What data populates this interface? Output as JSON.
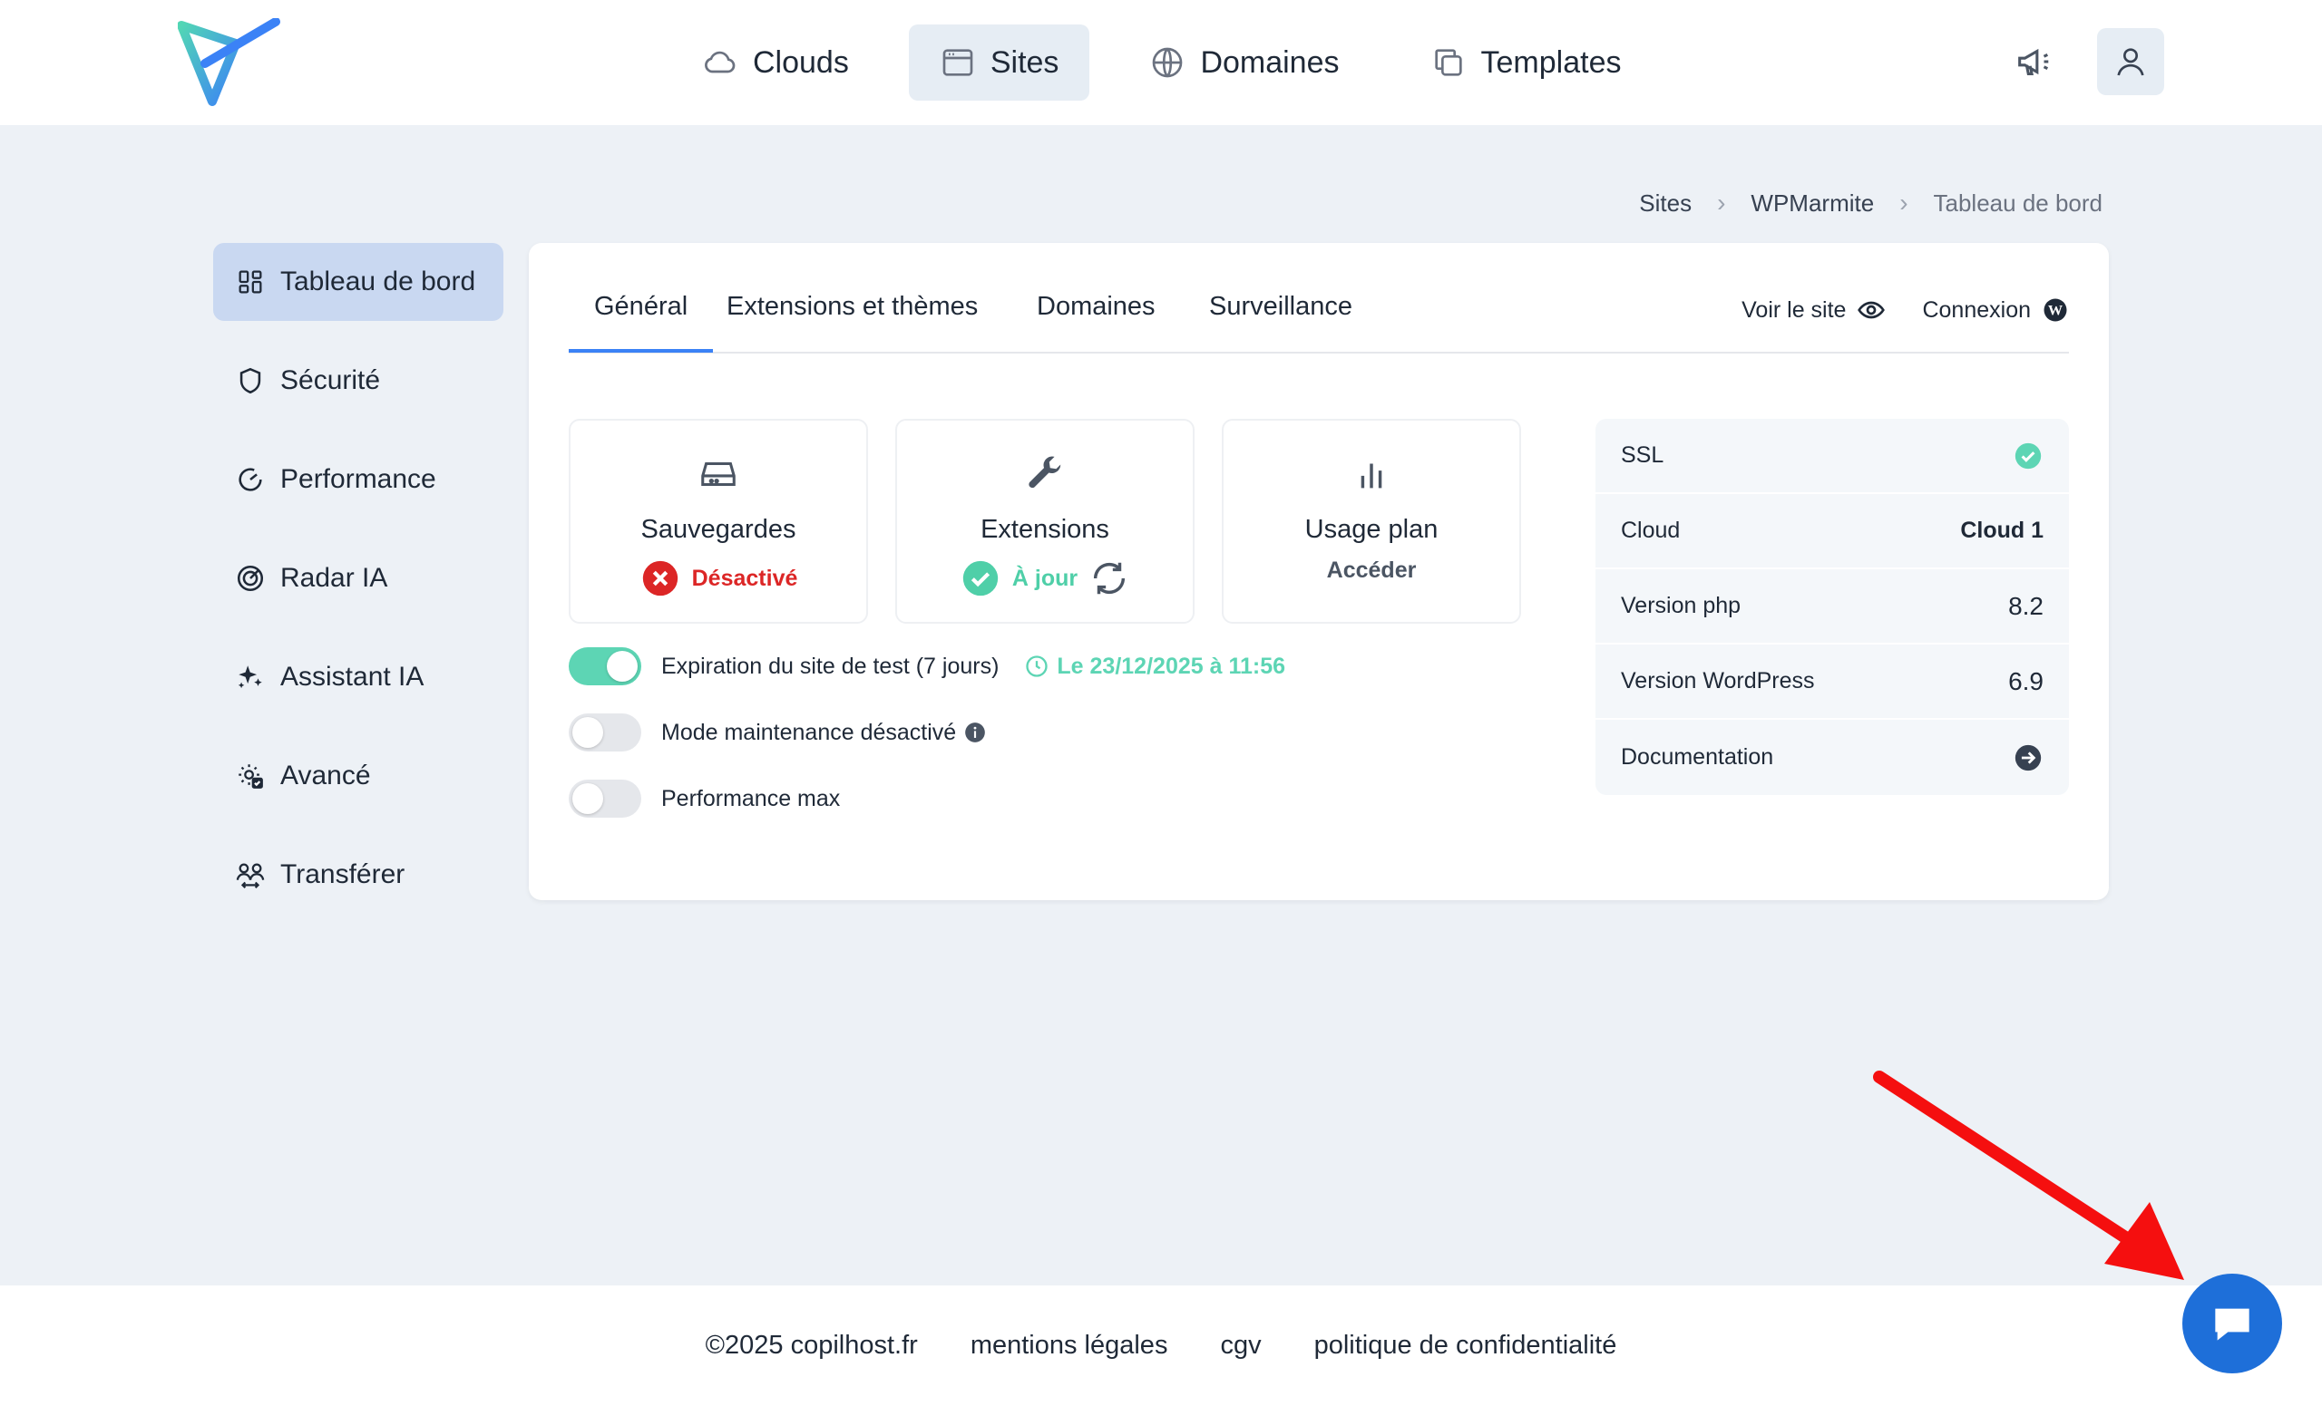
{
  "header": {
    "logo": "copilhost-logo",
    "nav": [
      {
        "label": "Clouds",
        "icon": "cloud-icon"
      },
      {
        "label": "Sites",
        "icon": "browser-window-icon",
        "active": true
      },
      {
        "label": "Domaines",
        "icon": "globe-icon"
      },
      {
        "label": "Templates",
        "icon": "copy-icon"
      }
    ],
    "announcements_icon": "megaphone-icon",
    "user_icon": "user-icon"
  },
  "breadcrumb": [
    "Sites",
    "WPMarmite",
    "Tableau de bord"
  ],
  "sidebar": {
    "items": [
      {
        "label": "Tableau de bord",
        "icon": "dashboard-grid-icon",
        "active": true
      },
      {
        "label": "Sécurité",
        "icon": "shield-icon"
      },
      {
        "label": "Performance",
        "icon": "gauge-icon"
      },
      {
        "label": "Radar IA",
        "icon": "radar-icon"
      },
      {
        "label": "Assistant IA",
        "icon": "sparkles-icon"
      },
      {
        "label": "Avancé",
        "icon": "gear-check-icon"
      },
      {
        "label": "Transférer",
        "icon": "users-transfer-icon"
      }
    ]
  },
  "tabs": {
    "items": [
      {
        "label": "Général",
        "active": true
      },
      {
        "label": "Extensions et thèmes"
      },
      {
        "label": "Domaines"
      },
      {
        "label": "Surveillance"
      }
    ],
    "view_site": "Voir le site",
    "login": "Connexion"
  },
  "tiles": [
    {
      "title": "Sauvegardes",
      "status": "Désactivé",
      "status_type": "error",
      "icon": "hard-drive-icon"
    },
    {
      "title": "Extensions",
      "status": "À jour",
      "status_type": "ok",
      "icon": "wrench-icon"
    },
    {
      "title": "Usage plan",
      "status": "Accéder",
      "status_type": "link",
      "icon": "bar-chart-icon"
    }
  ],
  "toggles": [
    {
      "label": "Expiration du site de test (7 jours)",
      "on": true,
      "extra": "Le 23/12/2025 à 11:56"
    },
    {
      "label": "Mode maintenance désactivé",
      "on": false
    },
    {
      "label": "Performance max",
      "on": false
    }
  ],
  "info": [
    {
      "label": "SSL",
      "value": ""
    },
    {
      "label": "Cloud",
      "value": "Cloud 1"
    },
    {
      "label": "Version php",
      "value": "8.2"
    },
    {
      "label": "Version WordPress",
      "value": "6.9"
    },
    {
      "label": "Documentation",
      "value": ""
    }
  ],
  "footer": [
    "©2025 copilhost.fr",
    "mentions légales",
    "cgv",
    "politique de confidentialité"
  ],
  "colors": {
    "accent": "#3b82f6",
    "success": "#4fcfa8",
    "error": "#dc2626",
    "chat": "#1e6fd9",
    "annotation": "#f50f0f"
  }
}
